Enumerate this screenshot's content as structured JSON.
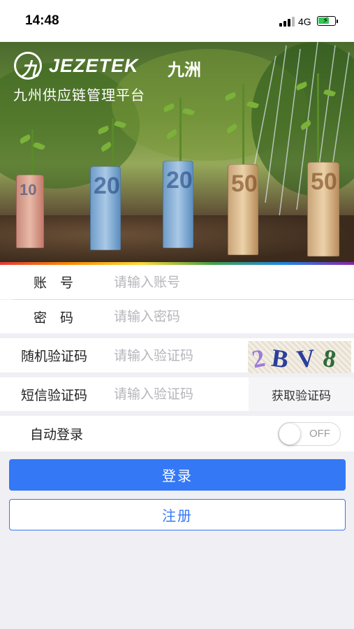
{
  "status_bar": {
    "time": "14:48",
    "network": "4G",
    "signal_icon": "signal-bars-icon",
    "battery_icon": "battery-charging-icon"
  },
  "banner": {
    "logo_glyph": "九",
    "brand_name": "JEZETEK",
    "brand_cn": "九洲",
    "platform_title": "九州供应链管理平台",
    "banknotes": [
      "10",
      "20",
      "20",
      "50",
      "50"
    ]
  },
  "form": {
    "account": {
      "label": "账　号",
      "placeholder": "请输入账号"
    },
    "password": {
      "label": "密　码",
      "placeholder": "请输入密码"
    },
    "captcha": {
      "label": "随机验证码",
      "placeholder": "请输入验证码",
      "image_chars": [
        "2",
        "B",
        "V",
        "8"
      ]
    },
    "sms": {
      "label": "短信验证码",
      "placeholder": "请输入验证码",
      "button_label": "获取验证码"
    },
    "auto_login": {
      "label": "自动登录",
      "toggle_state": "OFF"
    }
  },
  "actions": {
    "login_label": "登录",
    "register_label": "注册"
  },
  "colors": {
    "primary": "#3478f6",
    "background": "#efeff4"
  }
}
